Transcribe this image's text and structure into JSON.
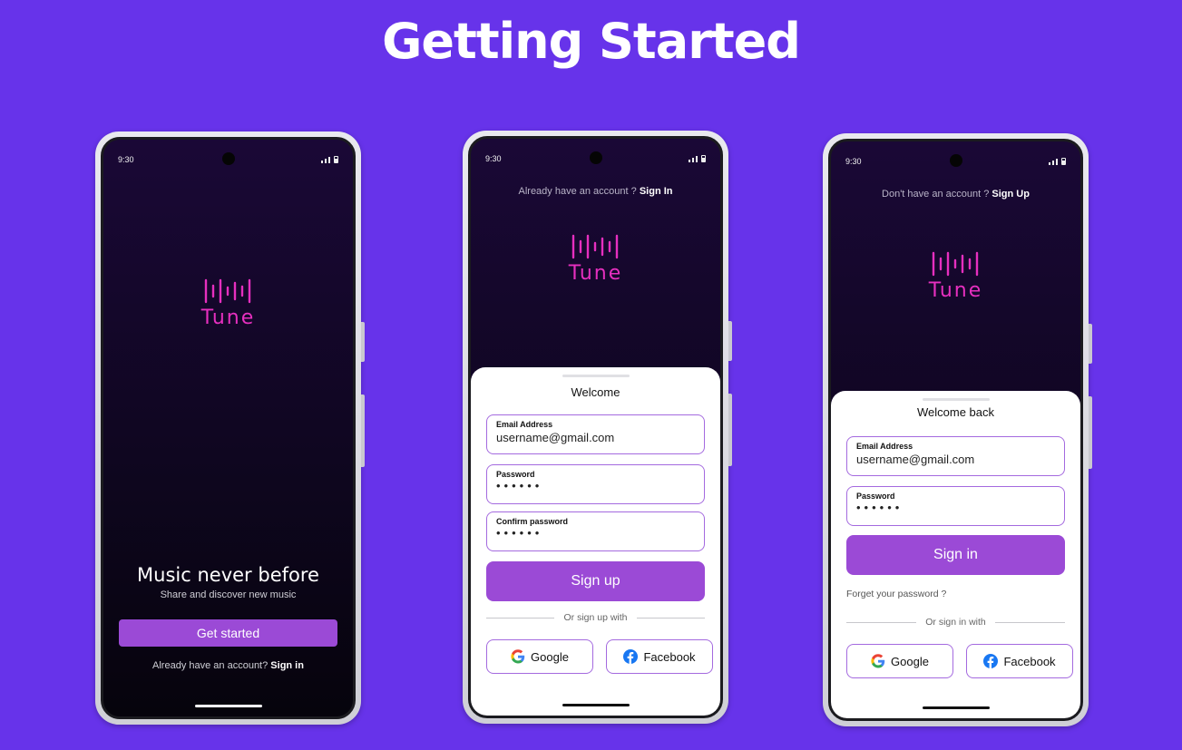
{
  "page": {
    "title": "Getting Started"
  },
  "status": {
    "time": "9:30"
  },
  "brand": {
    "name": "Tune",
    "accent": "#e62fbf"
  },
  "colors": {
    "background": "#6733ea",
    "primary_button": "#9b4ad6",
    "field_border": "#a46adf"
  },
  "onboarding": {
    "headline": "Music never before",
    "subheadline": "Share and discover new music",
    "cta_label": "Get started",
    "prompt_text": "Already have an account?",
    "prompt_link": "Sign in"
  },
  "signup": {
    "prompt_text": "Already have an account ?",
    "prompt_link": "Sign In",
    "title": "Welcome",
    "email_label": "Email Address",
    "email_value": "username@gmail.com",
    "password_label": "Password",
    "password_value": "••••••",
    "confirm_label": "Confirm password",
    "confirm_value": "••••••",
    "submit_label": "Sign up",
    "divider_text": "Or sign up with",
    "google_label": "Google",
    "facebook_label": "Facebook",
    "icons": {
      "google": "google-icon",
      "facebook": "facebook-icon"
    }
  },
  "signin": {
    "prompt_text": "Don't have an account ?",
    "prompt_link": "Sign Up",
    "title": "Welcome back",
    "email_label": "Email Address",
    "email_value": "username@gmail.com",
    "password_label": "Password",
    "password_value": "••••••",
    "submit_label": "Sign in",
    "forgot_label": "Forget your password ?",
    "divider_text": "Or sign in with",
    "google_label": "Google",
    "facebook_label": "Facebook"
  }
}
